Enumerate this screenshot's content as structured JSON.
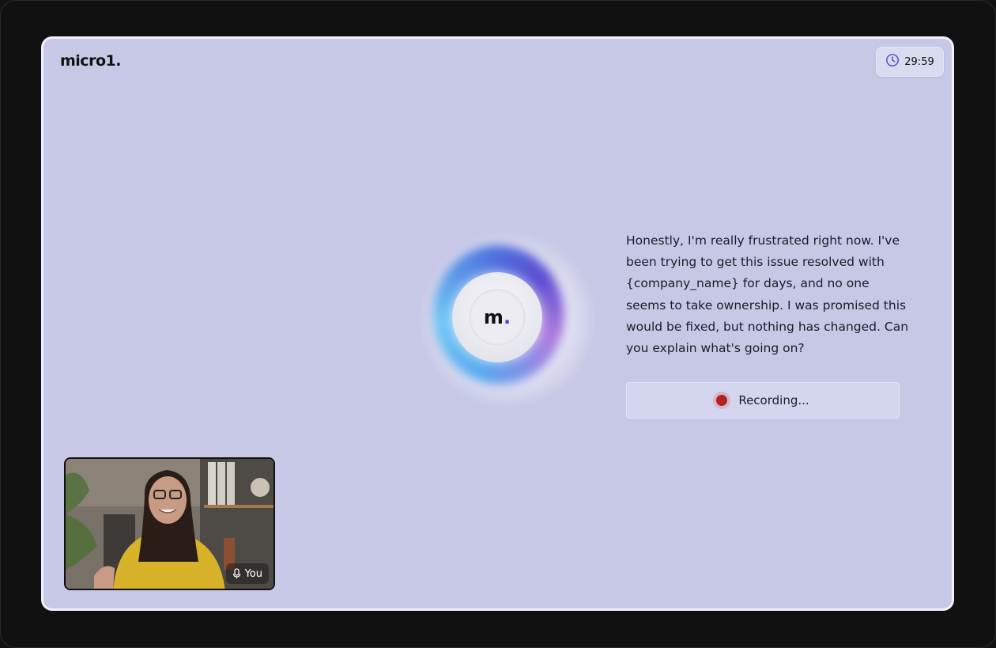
{
  "header": {
    "logo": "micro1.",
    "timer": "29:59"
  },
  "assistant": {
    "avatar_letter": "m",
    "avatar_dot": ".",
    "message": "Honestly, I'm really frustrated right now. I've been trying to get this issue resolved with {company_name} for days, and no one seems to take ownership. I was promised this would be fixed, but nothing has changed. Can you explain what's going on?"
  },
  "recording": {
    "label": "Recording..."
  },
  "self_view": {
    "label": "You"
  },
  "colors": {
    "background": "#c7c8e6",
    "recording_dot": "#b32222",
    "accent": "#4b4ad0"
  }
}
